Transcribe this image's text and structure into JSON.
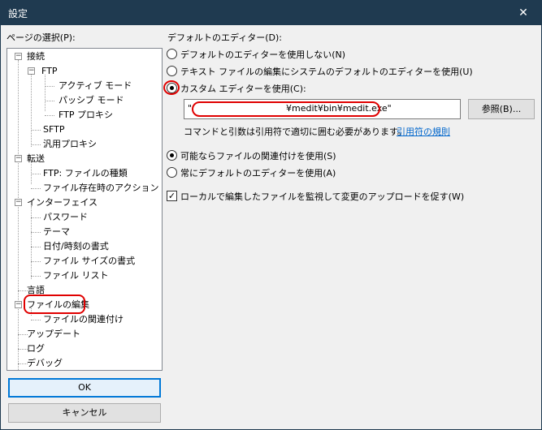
{
  "window": {
    "title": "設定",
    "close_glyph": "✕"
  },
  "left": {
    "heading": "ページの選択(P):",
    "tree": [
      "接続",
      "FTP",
      "アクティブ モード",
      "パッシブ モード",
      "FTP プロキシ",
      "SFTP",
      "汎用プロキシ",
      "転送",
      "FTP: ファイルの種類",
      "ファイル存在時のアクション",
      "インターフェイス",
      "パスワード",
      "テーマ",
      "日付/時刻の書式",
      "ファイル サイズの書式",
      "ファイル リスト",
      "言語",
      "ファイルの編集",
      "ファイルの関連付け",
      "アップデート",
      "ログ",
      "デバッグ"
    ],
    "expander_minus": "−",
    "ok_label": "OK",
    "cancel_label": "キャンセル"
  },
  "right": {
    "default_editor_heading": "デフォルトのエディター(D):",
    "radio_none": "デフォルトのエディターを使用しない(N)",
    "radio_system": "テキスト ファイルの編集にシステムのデフォルトのエディターを使用(U)",
    "radio_custom": "カスタム エディターを使用(C):",
    "custom_path_prefix": "\"",
    "custom_path": "¥medit¥bin¥medit.exe\"",
    "browse_label": "参照(B)...",
    "hint": "コマンドと引数は引用符で適切に囲む必要があります。",
    "hint_link": "引用符の規則",
    "radio_assoc": "可能ならファイルの関連付けを使用(S)",
    "radio_always_default": "常にデフォルトのエディターを使用(A)",
    "check_watch": "ローカルで編集したファイルを監視して変更のアップロードを促す(W)",
    "check_mark": "✓"
  },
  "colors": {
    "titlebar": "#1f3a50",
    "accent": "#0078d7",
    "annotation": "#e00000",
    "link": "#0066cc"
  }
}
